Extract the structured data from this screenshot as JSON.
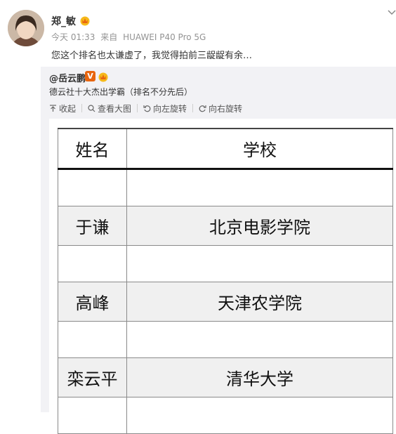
{
  "post": {
    "username": "郑_敏",
    "time": "今天 01:33",
    "source_prefix": "来自",
    "source": "HUAWEI P40 Pro 5G",
    "text": "您这个排名也太谦虚了，我觉得拍前三龊龊有余…"
  },
  "repost": {
    "author": "@岳云鹏",
    "verified_mark": "V",
    "text": "德云社十大杰出学霸（排名不分先后）",
    "actions": [
      {
        "label": "收起",
        "icon": "collapse-icon"
      },
      {
        "label": "查看大图",
        "icon": "search-icon"
      },
      {
        "label": "向左旋转",
        "icon": "rotate-left-icon"
      },
      {
        "label": "向右旋转",
        "icon": "rotate-right-icon"
      }
    ]
  },
  "table": {
    "headers": [
      "姓名",
      "学校"
    ],
    "rows": [
      {
        "name": "",
        "school": ""
      },
      {
        "name": "于谦",
        "school": "北京电影学院"
      },
      {
        "name": "",
        "school": ""
      },
      {
        "name": "高峰",
        "school": "天津农学院"
      },
      {
        "name": "",
        "school": ""
      },
      {
        "name": "栾云平",
        "school": "清华大学"
      },
      {
        "name": "",
        "school": ""
      }
    ]
  },
  "colors": {
    "accent_orange": "#e8650f",
    "repost_bg": "#f2f2f5",
    "meta_gray": "#939393"
  }
}
